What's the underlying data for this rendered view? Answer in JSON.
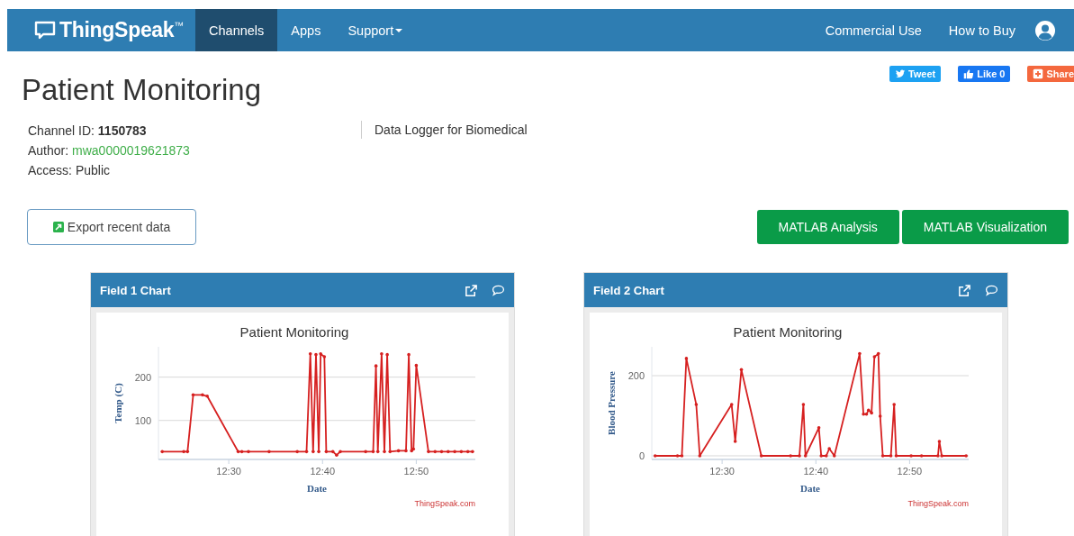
{
  "navbar": {
    "brand": "ThingSpeak$^{™}$",
    "items": [
      {
        "label": "Channels",
        "selected": true,
        "dropdown": false
      },
      {
        "label": "Apps",
        "selected": false,
        "dropdown": false
      },
      {
        "label": "Support",
        "selected": false,
        "dropdown": true
      }
    ],
    "right_items": [
      "Commercial Use",
      "How to Buy"
    ]
  },
  "social": [
    {
      "kind": "tweet",
      "label": "Tweet"
    },
    {
      "kind": "like",
      "label": "Like 0"
    },
    {
      "kind": "share",
      "label": "Share"
    }
  ],
  "title": "Patient Monitoring",
  "info": {
    "channel_id": "Channel ID: **1150783**",
    "author_label": "Author:",
    "author": "mwa0000019621873",
    "access": "Access: Public",
    "description": "Data Logger for Biomedical"
  },
  "export_button": "Export recent data",
  "matlab_buttons": [
    "MATLAB Analysis",
    "MATLAB Visualization"
  ],
  "charts": [
    {
      "header": "Field 1 Chart",
      "credit": "ThingSpeak.com",
      "chart_data": {
        "type": "line",
        "title": "Patient Monitoring",
        "xlabel": "Date",
        "ylabel": "Temp (C)",
        "xlim": [
          12.375,
          12.9383
        ],
        "ylim": [
          10,
          270
        ],
        "xticks": [
          {
            "value": 12.5,
            "label": "12:30"
          },
          {
            "value": 12.6667,
            "label": "12:40"
          },
          {
            "value": 12.8333,
            "label": "12:50"
          }
        ],
        "yticks": [
          100,
          200
        ],
        "x": [
          12.3817,
          12.42,
          12.4267,
          12.4367,
          12.4533,
          12.4617,
          12.5167,
          12.5233,
          12.535,
          12.5717,
          12.6217,
          12.6383,
          12.645,
          12.65,
          12.655,
          12.66,
          12.6633,
          12.67,
          12.6733,
          12.685,
          12.6917,
          12.6983,
          12.7433,
          12.7567,
          12.7617,
          12.765,
          12.7717,
          12.7767,
          12.7817,
          12.7867,
          12.8017,
          12.815,
          12.82,
          12.825,
          12.8283,
          12.8333,
          12.855,
          12.8667,
          12.8783,
          12.89,
          12.9017,
          12.9133,
          12.925,
          12.9333
        ],
        "series": [
          {
            "color": "#d62020",
            "values": [
              28,
              28,
              28,
              159,
              159,
              156,
              28,
              28,
              28,
              28,
              28,
              28,
              254,
              28,
              252,
              28,
              254,
              247,
              28,
              28,
              20,
              28,
              28,
              28,
              226,
              28,
              254,
              28,
              252,
              28,
              30,
              30,
              252,
              30,
              34,
              227,
              28,
              28,
              28,
              28,
              28,
              28,
              28,
              28
            ]
          }
        ]
      }
    },
    {
      "header": "Field 2 Chart",
      "credit": "ThingSpeak.com",
      "chart_data": {
        "type": "line",
        "title": "Patient Monitoring",
        "xlabel": "Date",
        "ylabel": "Blood Pressure",
        "xlim": [
          12.375,
          12.9383
        ],
        "ylim": [
          -9,
          272
        ],
        "xticks": [
          {
            "value": 12.5,
            "label": "12:30"
          },
          {
            "value": 12.6667,
            "label": "12:40"
          },
          {
            "value": 12.8333,
            "label": "12:50"
          }
        ],
        "yticks": [
          0,
          200
        ],
        "x": [
          12.381,
          12.4207,
          12.4285,
          12.4365,
          12.454,
          12.4603,
          12.517,
          12.5233,
          12.5343,
          12.5698,
          12.6217,
          12.6375,
          12.6445,
          12.6482,
          12.672,
          12.6762,
          12.6852,
          12.6905,
          12.6995,
          12.7445,
          12.7513,
          12.7567,
          12.7603,
          12.7657,
          12.7708,
          12.7778,
          12.781,
          12.7857,
          12.8,
          12.8058,
          12.8095,
          12.836,
          12.8545,
          12.8837,
          12.8862,
          12.8905,
          12.9338
        ],
        "series": [
          {
            "color": "#d62020",
            "values": [
              0,
              0,
              0,
              243,
              128,
              0,
              128,
              36,
              215,
              0,
              0,
              0,
              128,
              0,
              70,
              0,
              0,
              18,
              0,
              255,
              104,
              104,
              114,
              107,
              247,
              255,
              99,
              0,
              0,
              128,
              0,
              0,
              0,
              0,
              36,
              0,
              0
            ]
          }
        ]
      }
    }
  ]
}
